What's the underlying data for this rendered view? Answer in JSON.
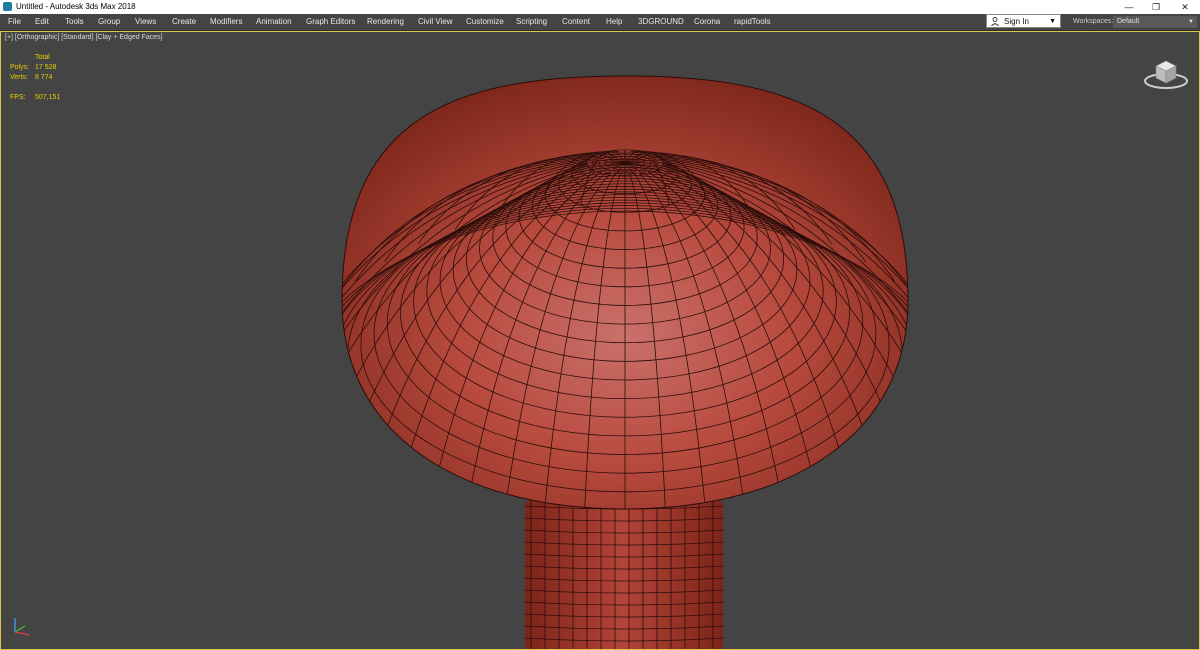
{
  "window": {
    "title": "Untitled - Autodesk 3ds Max 2018",
    "controls": {
      "minimize": "—",
      "restore": "❐",
      "close": "✕"
    }
  },
  "menu": {
    "items": [
      "File",
      "Edit",
      "Tools",
      "Group",
      "Views",
      "Create",
      "Modifiers",
      "Animation",
      "Graph Editors",
      "Rendering",
      "Civil View",
      "Customize",
      "Scripting",
      "Content",
      "Help",
      "3DGROUND",
      "Corona",
      "rapidTools"
    ]
  },
  "account": {
    "sign_in": "Sign In"
  },
  "workspace": {
    "label": "Workspaces:",
    "value": "Default"
  },
  "viewport": {
    "label": "[+] [Orthographic] [Standard] [Clay + Edged Faces]",
    "stats": {
      "header": "Total",
      "polys_label": "Polys:",
      "polys_value": "17 528",
      "verts_label": "Verts:",
      "verts_value": "8 774",
      "fps_label": "FPS:",
      "fps_value": "507,151"
    }
  },
  "colors": {
    "viewport_bg": "#444444",
    "mesh_fill": "#b8463a",
    "wire": "#2a0d0a",
    "stats_text": "#e8d000",
    "viewport_border": "#d8c54a"
  }
}
